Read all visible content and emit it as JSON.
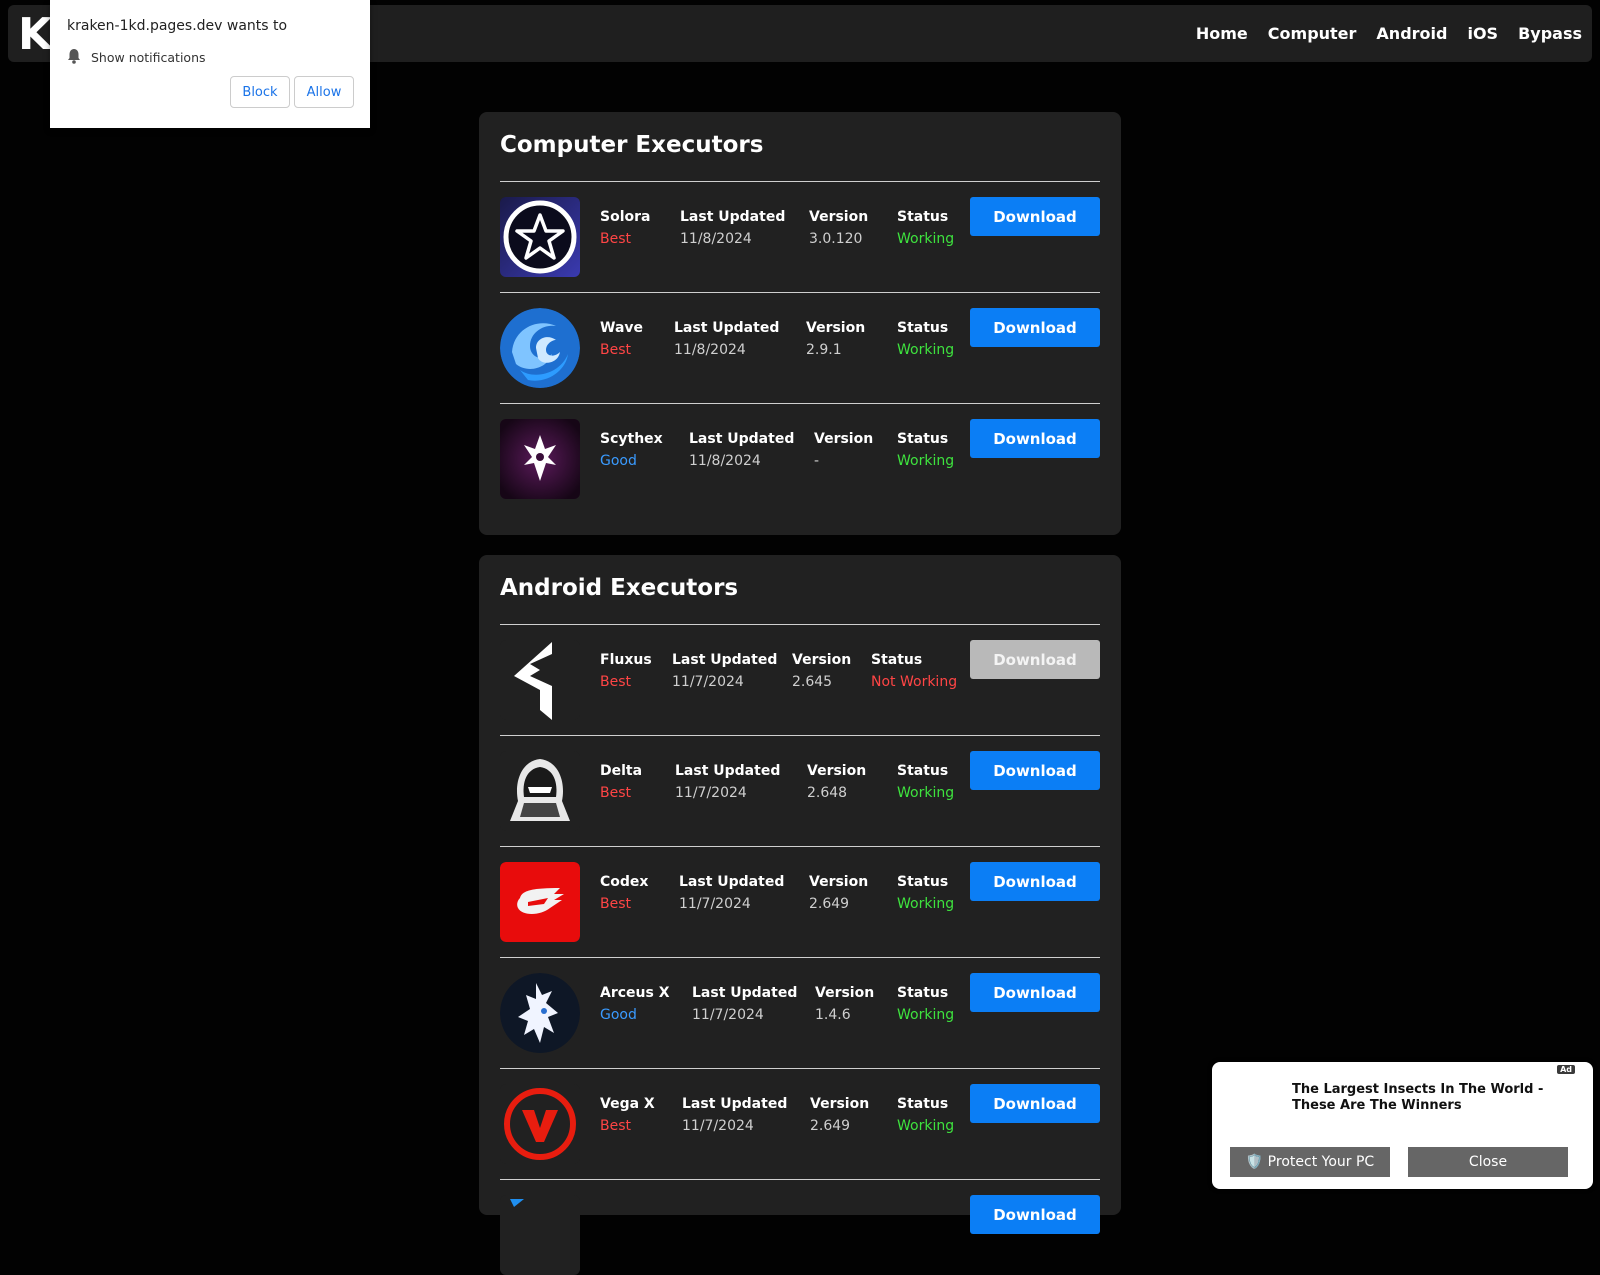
{
  "nav": {
    "brand": "K",
    "links": [
      "Home",
      "Computer",
      "Android",
      "iOS",
      "Bypass"
    ]
  },
  "labels": {
    "last_updated": "Last Updated",
    "version": "Version",
    "status": "Status",
    "download": "Download"
  },
  "computer": {
    "title": "Computer Executors",
    "items": [
      {
        "name": "Solora",
        "tier": "Best",
        "updated": "11/8/2024",
        "version": "3.0.120",
        "status": "Working"
      },
      {
        "name": "Wave",
        "tier": "Best",
        "updated": "11/8/2024",
        "version": "2.9.1",
        "status": "Working"
      },
      {
        "name": "Scythex",
        "tier": "Good",
        "updated": "11/8/2024",
        "version": "-",
        "status": "Working"
      }
    ]
  },
  "android": {
    "title": "Android Executors",
    "items": [
      {
        "name": "Fluxus",
        "tier": "Best",
        "updated": "11/7/2024",
        "version": "2.645",
        "status": "Not Working"
      },
      {
        "name": "Delta",
        "tier": "Best",
        "updated": "11/7/2024",
        "version": "2.648",
        "status": "Working"
      },
      {
        "name": "Codex",
        "tier": "Best",
        "updated": "11/7/2024",
        "version": "2.649",
        "status": "Working"
      },
      {
        "name": "Arceus X",
        "tier": "Good",
        "updated": "11/7/2024",
        "version": "1.4.6",
        "status": "Working"
      },
      {
        "name": "Vega X",
        "tier": "Best",
        "updated": "11/7/2024",
        "version": "2.649",
        "status": "Working"
      }
    ]
  },
  "notification": {
    "title": "kraken-1kd.pages.dev wants to",
    "line": "Show notifications",
    "block": "Block",
    "allow": "Allow"
  },
  "ad": {
    "badge": "Ad",
    "text": "The Largest Insects In The World - These Are The Winners",
    "protect": "🛡️ Protect Your PC",
    "close": "Close"
  },
  "colors": {
    "accent": "#0b7ef5",
    "best": "#ff4545",
    "good": "#3a9bff",
    "working": "#3ee23e",
    "not_working": "#ff4545"
  }
}
